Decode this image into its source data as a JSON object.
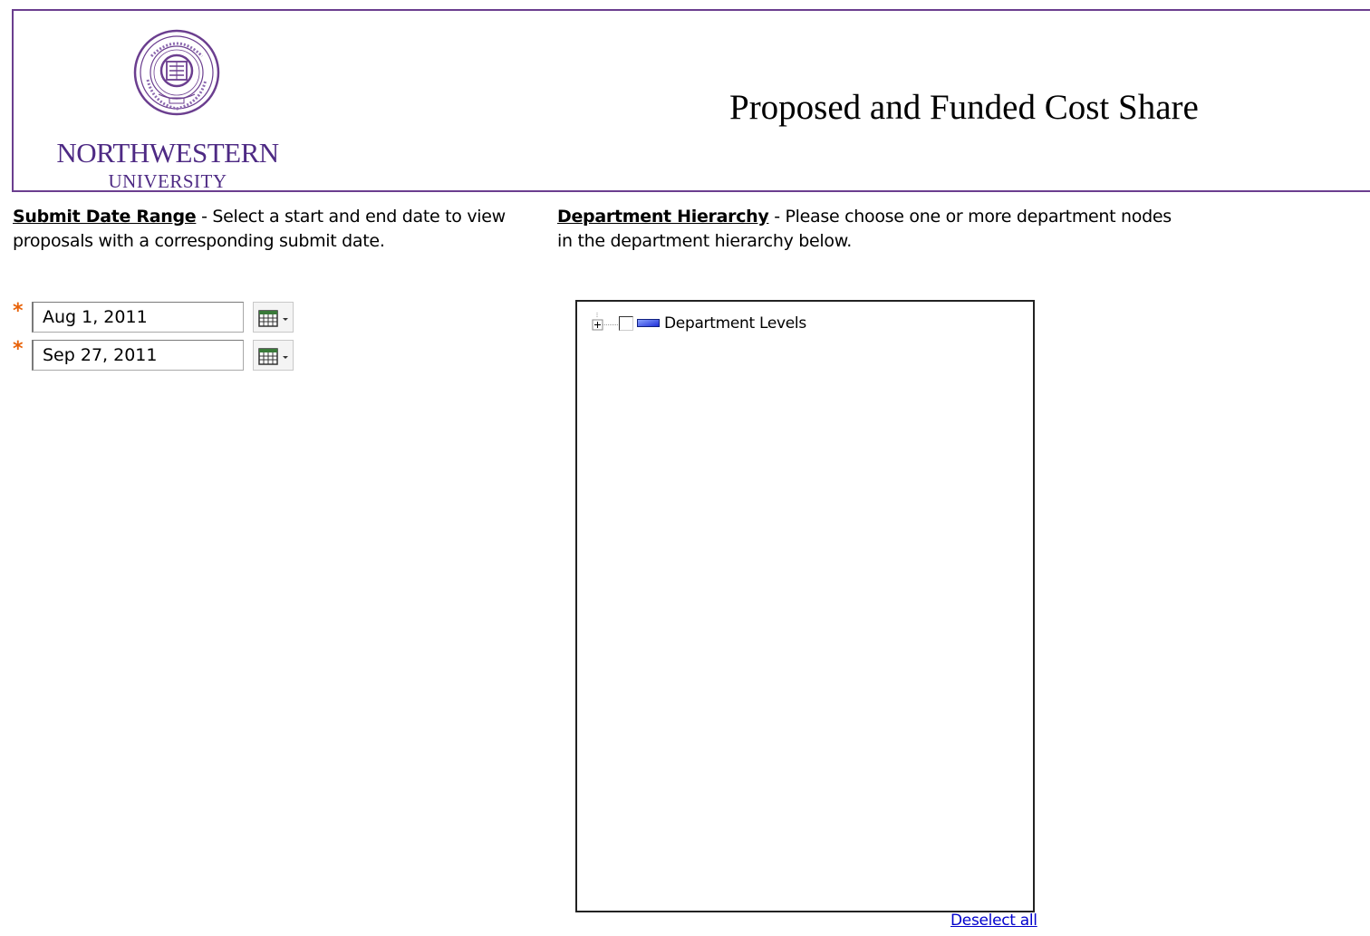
{
  "header": {
    "logo": {
      "wordmark": "NORTHWESTERN",
      "subword": "UNIVERSITY",
      "seal_icon": "university-seal-icon",
      "color": "#4e2a84"
    },
    "title": "Proposed and Funded Cost Share",
    "border_color": "#6b3e8f"
  },
  "date_section": {
    "heading": "Submit Date Range",
    "description_line1": " - Select a start and end date to view",
    "description_line2": "proposals with a corresponding submit date.",
    "required_marker": "*",
    "start_date": "Aug 1, 2011",
    "end_date": "Sep 27, 2011",
    "calendar_icon": "calendar-dropdown-icon"
  },
  "department_section": {
    "heading": "Department Hierarchy",
    "description_line1": " - Please choose one or more department nodes",
    "description_line2": "in the department hierarchy below.",
    "tree": {
      "root_label": "Department Levels",
      "expand_icon": "expand-plus-icon",
      "folder_icon": "department-folder-icon"
    },
    "deselect_label": "Deselect all"
  },
  "colors": {
    "required": "#e8630a",
    "link": "#0000cc"
  }
}
